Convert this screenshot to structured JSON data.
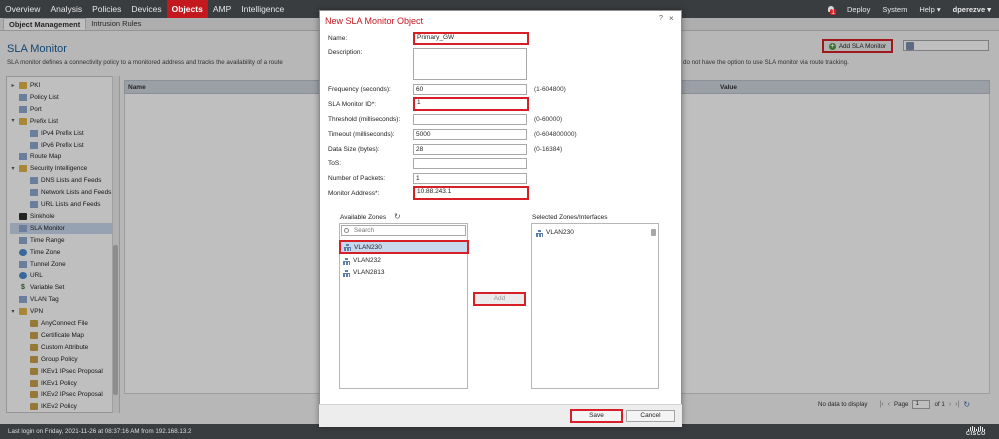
{
  "topnav": {
    "items": [
      "Overview",
      "Analysis",
      "Policies",
      "Devices",
      "Objects",
      "AMP",
      "Intelligence"
    ],
    "active_index": 4,
    "alert_count": "1",
    "deploy": "Deploy",
    "system": "System",
    "help": "Help ▾",
    "user": "dperezve ▾"
  },
  "subnav": {
    "tabs": [
      "Object Management",
      "Intrusion Rules"
    ],
    "active_index": 0
  },
  "page": {
    "title": "SLA Monitor",
    "description": "SLA monitor defines a connectivity policy to a monitored address and tracks the availability of a route",
    "description_tail": "do not have the option to use SLA monitor via route tracking.",
    "add_button": "Add SLA Monitor"
  },
  "tree": {
    "items": [
      {
        "label": "PKI",
        "icon": "folder",
        "indent": 0,
        "expander": "▸"
      },
      {
        "label": "Policy List",
        "icon": "page",
        "indent": 0
      },
      {
        "label": "Port",
        "icon": "page",
        "indent": 0
      },
      {
        "label": "Prefix List",
        "icon": "folder",
        "indent": 0,
        "expander": "▾"
      },
      {
        "label": "IPv4 Prefix List",
        "icon": "page",
        "indent": 1
      },
      {
        "label": "IPv6 Prefix List",
        "icon": "page",
        "indent": 1
      },
      {
        "label": "Route Map",
        "icon": "page",
        "indent": 0
      },
      {
        "label": "Security Intelligence",
        "icon": "folder",
        "indent": 0,
        "expander": "▾"
      },
      {
        "label": "DNS Lists and Feeds",
        "icon": "page",
        "indent": 1
      },
      {
        "label": "Network Lists and Feeds",
        "icon": "page",
        "indent": 1
      },
      {
        "label": "URL Lists and Feeds",
        "icon": "page",
        "indent": 1
      },
      {
        "label": "Sinkhole",
        "icon": "dark",
        "indent": 0
      },
      {
        "label": "SLA Monitor",
        "icon": "page",
        "indent": 0,
        "selected": true
      },
      {
        "label": "Time Range",
        "icon": "page",
        "indent": 0
      },
      {
        "label": "Time Zone",
        "icon": "globe",
        "indent": 0
      },
      {
        "label": "Tunnel Zone",
        "icon": "page",
        "indent": 0
      },
      {
        "label": "URL",
        "icon": "globe",
        "indent": 0
      },
      {
        "label": "Variable Set",
        "icon": "dollar",
        "indent": 0
      },
      {
        "label": "VLAN Tag",
        "icon": "page",
        "indent": 0
      },
      {
        "label": "VPN",
        "icon": "folder",
        "indent": 0,
        "expander": "▾"
      },
      {
        "label": "AnyConnect File",
        "icon": "lock",
        "indent": 1
      },
      {
        "label": "Certificate Map",
        "icon": "lock",
        "indent": 1
      },
      {
        "label": "Custom Attribute",
        "icon": "lock",
        "indent": 1
      },
      {
        "label": "Group Policy",
        "icon": "lock",
        "indent": 1
      },
      {
        "label": "IKEv1 IPsec Proposal",
        "icon": "lock",
        "indent": 1
      },
      {
        "label": "IKEv1 Policy",
        "icon": "lock",
        "indent": 1
      },
      {
        "label": "IKEv2 IPsec Proposal",
        "icon": "lock",
        "indent": 1
      },
      {
        "label": "IKEv2 Policy",
        "icon": "lock",
        "indent": 1
      }
    ]
  },
  "list": {
    "col_name": "Name",
    "col_value": "Value",
    "no_data": "No data to display",
    "page_label": "Page",
    "page_value": "1",
    "of_label": "of 1"
  },
  "status": {
    "last_login": "Last login on Friday, 2021-11-26 at 08:37:16 AM from 192.168.13.2"
  },
  "modal": {
    "title": "New SLA Monitor Object",
    "help": "?",
    "close": "×",
    "fields": {
      "name": {
        "label": "Name:",
        "value": "Primary_GW"
      },
      "description": {
        "label": "Description:"
      },
      "frequency": {
        "label": "Frequency (seconds):",
        "value": "60",
        "hint": "(1-604800)"
      },
      "sla_id": {
        "label": "SLA Monitor ID*:",
        "value": "1"
      },
      "threshold": {
        "label": "Threshold (milliseconds):",
        "value": "",
        "hint": "(0-60000)"
      },
      "timeout": {
        "label": "Timeout (milliseconds):",
        "value": "5000",
        "hint": "(0-604800000)"
      },
      "data_size": {
        "label": "Data Size (bytes):",
        "value": "28",
        "hint": "(0-16384)"
      },
      "tos": {
        "label": "ToS:",
        "value": ""
      },
      "packets": {
        "label": "Number of Packets:",
        "value": "1"
      },
      "monitor_address": {
        "label": "Monitor Address*:",
        "value": "10.88.243.1"
      }
    },
    "available_zones": {
      "label": "Available Zones",
      "search_placeholder": "Search",
      "items": [
        "VLAN230",
        "VLAN232",
        "VLAN2813"
      ]
    },
    "selected_zones": {
      "label": "Selected Zones/Interfaces",
      "items": [
        "VLAN230"
      ]
    },
    "add_button": "Add",
    "save_button": "Save",
    "cancel_button": "Cancel"
  }
}
